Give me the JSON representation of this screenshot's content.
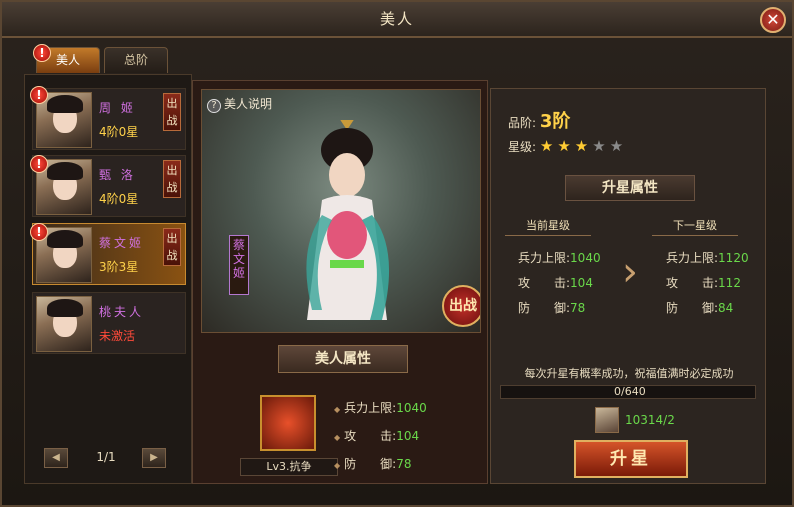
{
  "window": {
    "title": "美人",
    "close_glyph": "✕"
  },
  "tabs": [
    {
      "label": "美人"
    },
    {
      "label": "总阶"
    }
  ],
  "characters": [
    {
      "name": "周 姬",
      "rank": "4阶0星",
      "battle": "出战"
    },
    {
      "name": "甄 洛",
      "rank": "4阶0星",
      "battle": "出战"
    },
    {
      "name": "蔡文姬",
      "rank": "3阶3星",
      "battle": "出战"
    },
    {
      "name": "桃夫人",
      "rank": "未激活"
    }
  ],
  "pager": {
    "prev": "◀",
    "text": "1/1",
    "next": "▶"
  },
  "portrait": {
    "help_label": "美人说明",
    "name_vertical": "蔡文姬",
    "battle_button": "出战"
  },
  "beauty_attrs": {
    "header": "美人属性",
    "skill_label": "Lv3.抗争",
    "hp_label": "兵力上限:",
    "hp_value": "1040",
    "atk_label": "攻　　击:",
    "atk_value": "104",
    "def_label": "防　　御:",
    "def_value": "78"
  },
  "grade": {
    "label": "品阶:",
    "value": "3阶"
  },
  "stars": {
    "label": "星级:",
    "filled": 3,
    "total": 5,
    "glyph": "★"
  },
  "upgrade": {
    "header": "升星属性",
    "current_head": "当前星级",
    "next_head": "下一星级",
    "current": {
      "hp_label": "兵力上限:",
      "hp": "1040",
      "atk_label": "攻　　击:",
      "atk": "104",
      "def_label": "防　　御:",
      "def": "78"
    },
    "next": {
      "hp_label": "兵力上限:",
      "hp": "1120",
      "atk_label": "攻　　击:",
      "atk": "112",
      "def_label": "防　　御:",
      "def": "84"
    },
    "hint": "每次升星有概率成功，祝福值满时必定成功",
    "progress_text": "0/640",
    "progress_fraction": 0,
    "item_count": "10314/2",
    "button": "升星"
  }
}
